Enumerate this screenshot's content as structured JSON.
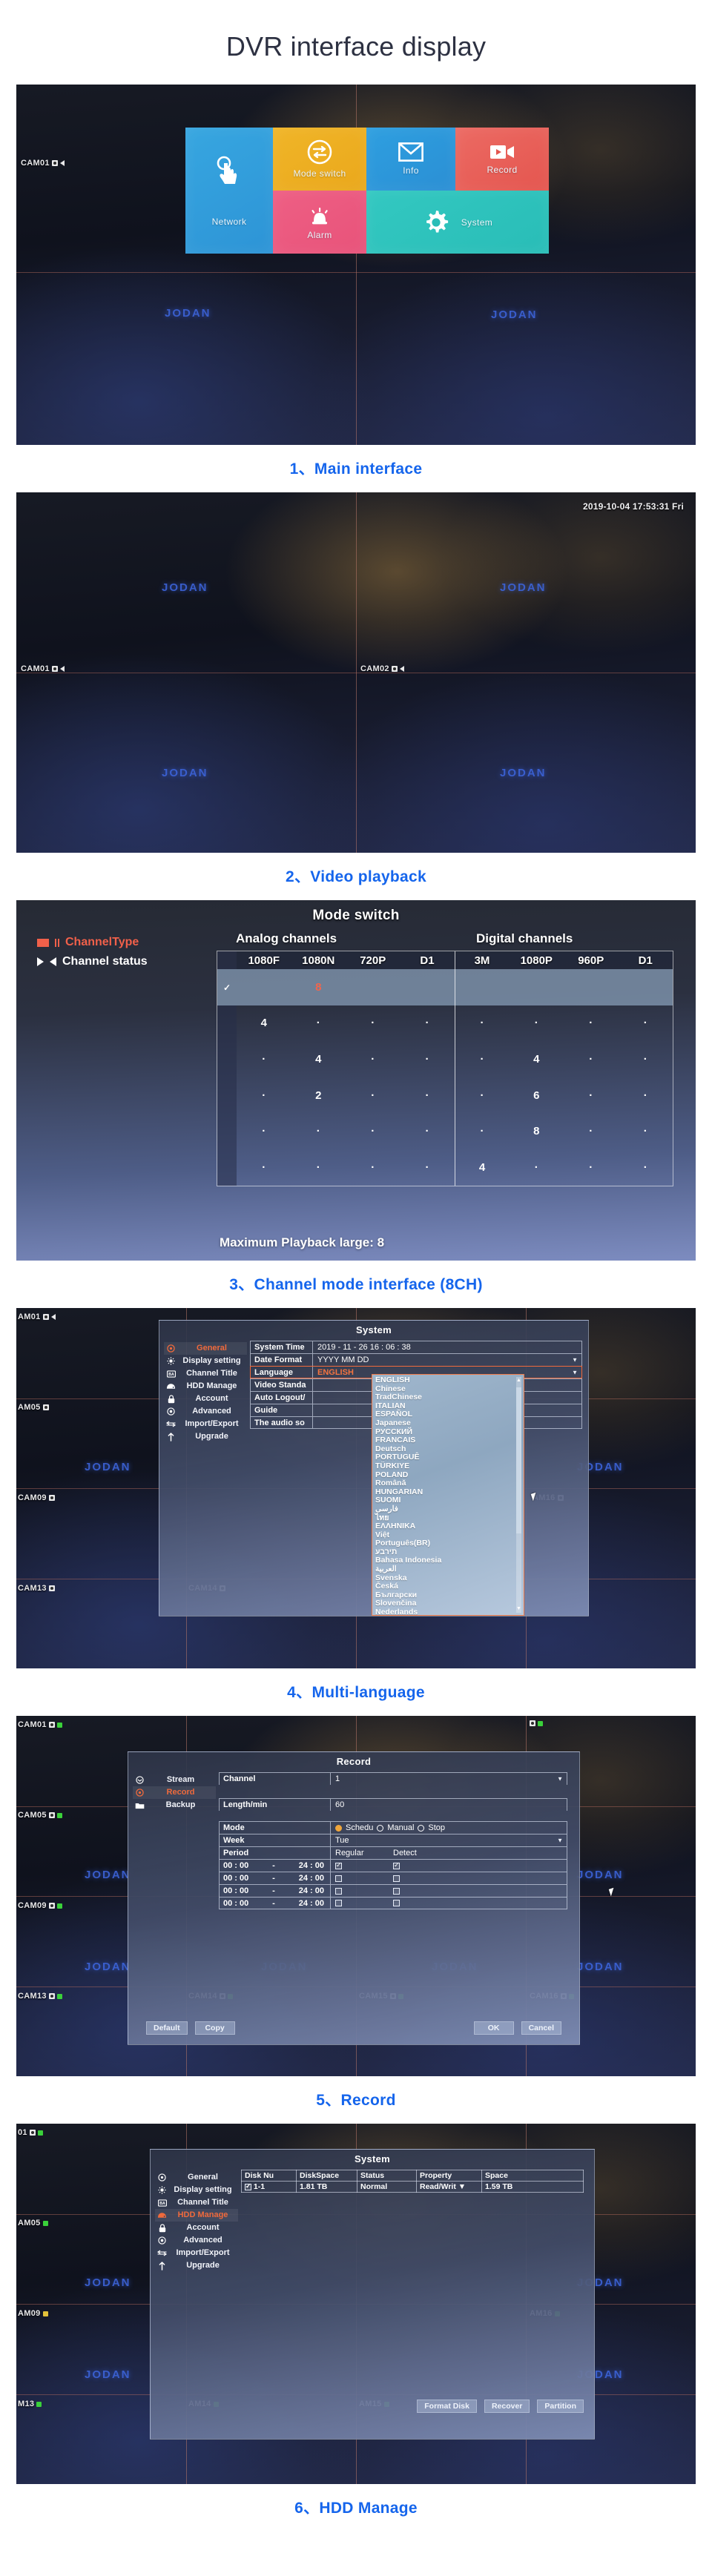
{
  "page": {
    "title": "DVR interface display"
  },
  "brand": {
    "watermark": "JODAN"
  },
  "panels": [
    {
      "caption": "1、Main interface",
      "cam_tags": [
        "CAM01"
      ],
      "tiles": [
        {
          "label": "Network",
          "icon": "touch-hand-icon",
          "color": "#2d94d6"
        },
        {
          "label": "Mode switch",
          "icon": "switch-arrows-icon",
          "color": "#eaa81c"
        },
        {
          "label": "Info",
          "icon": "envelope-icon",
          "color": "#2b8fd4"
        },
        {
          "label": "Record",
          "icon": "video-camera-icon",
          "color": "#e4564f"
        },
        {
          "label": "Alarm",
          "icon": "siren-icon",
          "color": "#e8537a"
        },
        {
          "label": "System",
          "icon": "gear-icon",
          "color": "#29bdb7"
        }
      ]
    },
    {
      "caption": "2、Video playback",
      "timestamp": "2019-10-04 17:53:31 Fri",
      "cam_tags": [
        "CAM01",
        "CAM02"
      ]
    },
    {
      "caption": "3、Channel mode interface (8CH)",
      "title": "Mode switch",
      "legend": [
        {
          "label": "ChannelType",
          "icon": "channel-type-icon"
        },
        {
          "label": "Channel status",
          "icon": "channel-status-icon"
        }
      ],
      "footer": "Maximum Playback large: 8"
    },
    {
      "caption": "4、Multi-language",
      "dialog_title": "System",
      "nav": [
        {
          "label": "General",
          "icon": "general-icon",
          "active": true
        },
        {
          "label": "Display setting",
          "icon": "display-icon",
          "active": false
        },
        {
          "label": "Channel Title",
          "icon": "channel-title-icon",
          "active": false
        },
        {
          "label": "HDD Manage",
          "icon": "hdd-icon",
          "active": false
        },
        {
          "label": "Account",
          "icon": "lock-icon",
          "active": false
        },
        {
          "label": "Advanced",
          "icon": "advanced-icon",
          "active": false
        },
        {
          "label": "Import/Export",
          "icon": "import-export-icon",
          "active": false
        },
        {
          "label": "Upgrade",
          "icon": "upgrade-arrow-icon",
          "active": false
        }
      ],
      "form": [
        {
          "key": "System Time",
          "value": "2019  -  11  -  26      16 : 06 : 38",
          "caret": false
        },
        {
          "key": "Date Format",
          "value": "YYYY MM DD",
          "caret": true
        },
        {
          "key": "Language",
          "value": "ENGLISH",
          "caret": true,
          "highlight": true
        },
        {
          "key": "Video Standa",
          "value": "",
          "caret": false
        },
        {
          "key": "Auto Logout/",
          "value": "",
          "caret": false
        },
        {
          "key": "Guide",
          "value": "",
          "caret": false
        },
        {
          "key": "The audio so",
          "value": "",
          "caret": false
        }
      ],
      "languages": [
        "ENGLISH",
        "Chinese",
        "TradChinese",
        "ITALIAN",
        "ESPAÑOL",
        "Japanese",
        "РУССКИЙ",
        "FRANCAIS",
        "Deutsch",
        "PORTUGUÊ",
        "TÜRKIYE",
        "POLAND",
        "Română",
        "HUNGARIAN",
        "SUOMI",
        "فارسی",
        "ไทย",
        "ΕΛΛΗΝΙΚΑ",
        "Việt",
        "Português(BR)",
        "תירבע",
        "Bahasa Indonesia",
        "العربية",
        "Svenska",
        "Česká",
        "Български",
        "Slovenčina",
        "Nederlands"
      ],
      "cam_tags": [
        "AM01",
        "AM05",
        "CAM09",
        "CAM13",
        "CAM14",
        "AM16"
      ]
    },
    {
      "caption": "5、Record",
      "dialog_title": "Record",
      "nav": [
        {
          "label": "Stream",
          "icon": "stream-icon",
          "active": false
        },
        {
          "label": "Record",
          "icon": "record-icon",
          "active": true
        },
        {
          "label": "Backup",
          "icon": "folder-icon",
          "active": false
        }
      ],
      "fields": [
        {
          "key": "Channel",
          "value": "1",
          "caret": true
        },
        {
          "key": "Length/min",
          "value": "60",
          "caret": false
        }
      ],
      "mode": {
        "key": "Mode",
        "options": [
          "Schedu",
          "Manual",
          "Stop"
        ],
        "selected": "Schedu"
      },
      "week": {
        "key": "Week",
        "value": "Tue",
        "caret": true
      },
      "period": {
        "key": "Period",
        "columns": [
          "Regular",
          "Detect"
        ],
        "rows": [
          {
            "from": "00 : 00",
            "to": "24 : 00",
            "regular": true,
            "detect": true
          },
          {
            "from": "00 : 00",
            "to": "24 : 00",
            "regular": false,
            "detect": false
          },
          {
            "from": "00 : 00",
            "to": "24 : 00",
            "regular": false,
            "detect": false
          },
          {
            "from": "00 : 00",
            "to": "24 : 00",
            "regular": false,
            "detect": false
          }
        ]
      },
      "buttons_left": [
        "Default",
        "Copy"
      ],
      "buttons_right": [
        "OK",
        "Cancel"
      ],
      "cam_tags": [
        "CAM01",
        "CAM05",
        "CAM09",
        "CAM13",
        "CAM14",
        "CAM15",
        "CAM16"
      ]
    },
    {
      "caption": "6、HDD Manage",
      "dialog_title": "System",
      "nav": [
        {
          "label": "General",
          "icon": "general-icon",
          "active": false
        },
        {
          "label": "Display setting",
          "icon": "display-icon",
          "active": false
        },
        {
          "label": "Channel Title",
          "icon": "channel-title-icon",
          "active": false
        },
        {
          "label": "HDD Manage",
          "icon": "hdd-icon",
          "active": true
        },
        {
          "label": "Account",
          "icon": "lock-icon",
          "active": false
        },
        {
          "label": "Advanced",
          "icon": "advanced-icon",
          "active": false
        },
        {
          "label": "Import/Export",
          "icon": "import-export-icon",
          "active": false
        },
        {
          "label": "Upgrade",
          "icon": "upgrade-arrow-icon",
          "active": false
        }
      ],
      "table": {
        "headers": [
          "Disk Nu",
          "DiskSpace",
          "Status",
          "Property",
          "Space"
        ],
        "rows": [
          {
            "checked": true,
            "disk": "1-1",
            "space_total": "1.81 TB",
            "status": "Normal",
            "property": "Read/Writ",
            "space_free": "1.59 TB"
          }
        ]
      },
      "buttons": [
        "Format Disk",
        "Recover",
        "Partition"
      ],
      "cam_tags": [
        "01",
        "AM05",
        "AM09",
        "M13",
        "AM14",
        "AM15",
        "AM16"
      ]
    }
  ],
  "mode_switch_table": {
    "group_headers": [
      "Analog channels",
      "Digital channels"
    ],
    "columns": [
      "1080F",
      "1080N",
      "720P",
      "D1",
      "3M",
      "1080P",
      "960P",
      "D1"
    ],
    "rows": [
      {
        "selected": true,
        "cells": [
          "",
          "8",
          "",
          "",
          "",
          "",
          "",
          ""
        ]
      },
      {
        "selected": false,
        "cells": [
          "4",
          "·",
          "·",
          "·",
          "·",
          "·",
          "·",
          "·"
        ]
      },
      {
        "selected": false,
        "cells": [
          "·",
          "4",
          "·",
          "·",
          "·",
          "4",
          "·",
          "·"
        ]
      },
      {
        "selected": false,
        "cells": [
          "·",
          "2",
          "·",
          "·",
          "·",
          "6",
          "·",
          "·"
        ]
      },
      {
        "selected": false,
        "cells": [
          "·",
          "·",
          "·",
          "·",
          "·",
          "8",
          "·",
          "·"
        ]
      },
      {
        "selected": false,
        "cells": [
          "·",
          "·",
          "·",
          "·",
          "4",
          "·",
          "·",
          "·"
        ]
      }
    ]
  }
}
